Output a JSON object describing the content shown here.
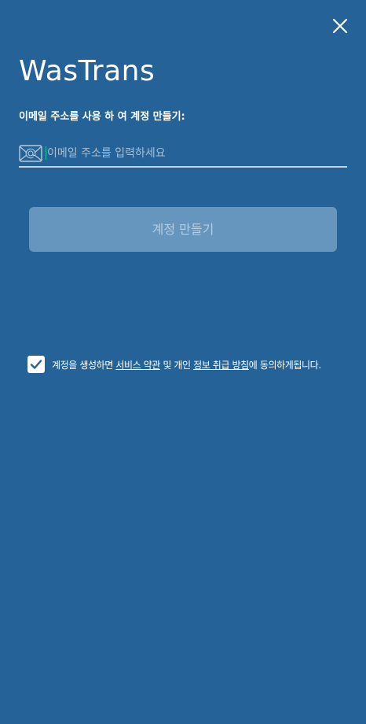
{
  "header": {
    "close_icon": "close-icon",
    "title": "WasTrans"
  },
  "form": {
    "subtitle": "이메일 주소를 사용 하 여 계정 만들기:",
    "email_icon": "email-at-icon",
    "email_placeholder": "이메일 주소를 입력하세요",
    "email_value": "",
    "create_button_label": "계정 만들기"
  },
  "consent": {
    "checked": true,
    "text_before": "계정을 생성하면 ",
    "terms_link": "서비스 약관",
    "text_middle": " 및 개인 ",
    "privacy_link": "정보 취급 방침",
    "text_after": "에 동의하게됩니다."
  },
  "colors": {
    "background": "#246297",
    "button_disabled": "#6696be",
    "button_text": "#b8cde0",
    "caret": "#19c7a0",
    "input_underline": "#c7d5e3"
  }
}
